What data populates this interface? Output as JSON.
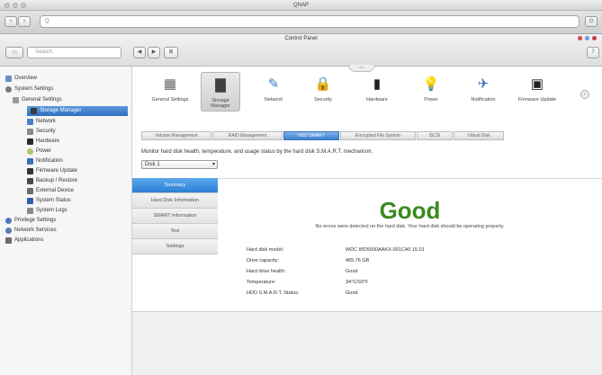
{
  "window": {
    "title": "QNAP"
  },
  "browser": {
    "url": "Q"
  },
  "app": {
    "title": "Control Panel",
    "search_placeholder": "Search"
  },
  "sidebar": {
    "items": [
      {
        "label": "Overview",
        "icon": "overview-icon"
      },
      {
        "label": "System Settings",
        "icon": "system-settings-icon"
      },
      {
        "label": "General Settings",
        "icon": "general-settings-icon"
      },
      {
        "label": "Storage Manager",
        "icon": "storage-manager-icon",
        "selected": true
      },
      {
        "label": "Network",
        "icon": "network-icon"
      },
      {
        "label": "Security",
        "icon": "security-icon"
      },
      {
        "label": "Hardware",
        "icon": "hardware-icon"
      },
      {
        "label": "Power",
        "icon": "power-icon"
      },
      {
        "label": "Notification",
        "icon": "notification-icon"
      },
      {
        "label": "Firmware Update",
        "icon": "firmware-update-icon"
      },
      {
        "label": "Backup / Restore",
        "icon": "backup-icon"
      },
      {
        "label": "External Device",
        "icon": "external-device-icon"
      },
      {
        "label": "System Status",
        "icon": "system-status-icon"
      },
      {
        "label": "System Logs",
        "icon": "system-logs-icon"
      },
      {
        "label": "Privilege Settings",
        "icon": "privilege-icon"
      },
      {
        "label": "Network Services",
        "icon": "network-services-icon"
      },
      {
        "label": "Applications",
        "icon": "applications-icon"
      }
    ]
  },
  "apps": [
    {
      "label": "General Settings",
      "icon": "general-settings-icon",
      "glyph": "▦"
    },
    {
      "label": "Storage Manager",
      "icon": "storage-manager-icon",
      "glyph": "▇",
      "selected": true
    },
    {
      "label": "Network",
      "icon": "network-icon",
      "glyph": "✎"
    },
    {
      "label": "Security",
      "icon": "lock-icon",
      "glyph": "🔒"
    },
    {
      "label": "Hardware",
      "icon": "hardware-icon",
      "glyph": "▮"
    },
    {
      "label": "Power",
      "icon": "lightbulb-icon",
      "glyph": "💡"
    },
    {
      "label": "Notification",
      "icon": "satellite-icon",
      "glyph": "✈"
    },
    {
      "label": "Firmware Update",
      "icon": "firmware-icon",
      "glyph": "▣"
    }
  ],
  "tabs": [
    "Volume Management",
    "RAID Management",
    "HDD SMART",
    "Encrypted File System",
    "iSCSI",
    "Virtual Disk"
  ],
  "active_tab": "HDD SMART",
  "description": "Monitor hard disk health, temperature, and usage status by the hard disk S.M.A.R.T. mechanism.",
  "disk_select": {
    "value": "Disk 1"
  },
  "left_tabs": [
    "Summary",
    "Hard Disk Information",
    "SMART Information",
    "Test",
    "Settings"
  ],
  "status": {
    "headline": "Good",
    "message": "No errors were detected on the hard disk. Your hard disk should be operating properly."
  },
  "details": [
    {
      "key": "Hard disk model:",
      "value": "WDC WD5000AAKX-001CA0 15.01"
    },
    {
      "key": "Drive capacity:",
      "value": "465.76 GB"
    },
    {
      "key": "Hard drive health:",
      "value": "Good"
    },
    {
      "key": "Temperature:",
      "value": "34°C/93°F"
    },
    {
      "key": "HDD S.M.A.R.T. Status:",
      "value": "Good"
    }
  ]
}
